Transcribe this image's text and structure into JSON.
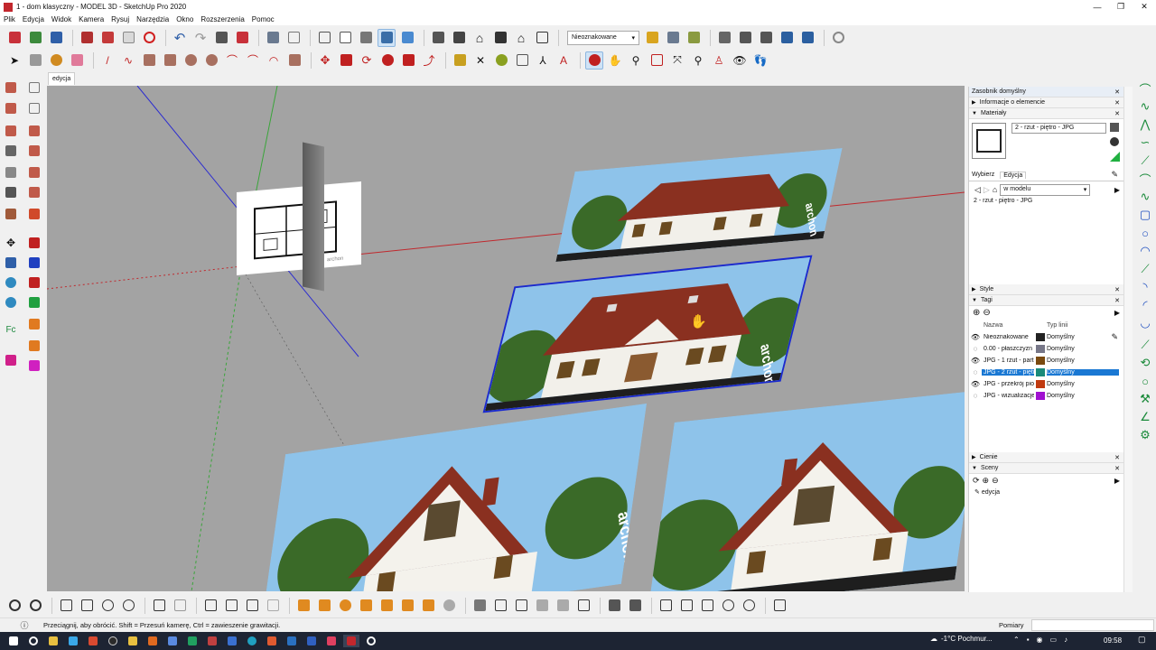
{
  "window": {
    "title": "1 - dom klasyczny - MODEL 3D - SketchUp Pro 2020",
    "controls": [
      "—",
      "❐",
      "✕"
    ]
  },
  "menu": [
    "Plik",
    "Edycja",
    "Widok",
    "Kamera",
    "Rysuj",
    "Narzędzia",
    "Okno",
    "Rozszerzenia",
    "Pomoc"
  ],
  "toolbar": {
    "style_dropdown": "Nieoznakowane",
    "scene_tab": "edycja"
  },
  "colors": {
    "viewport": "#a3a3a3",
    "axis_red": "#c0282d",
    "axis_green": "#3aa53a",
    "axis_blue": "#2b2bd0",
    "selection": "#1a78d3"
  },
  "scene_images": [
    {
      "label": "archon",
      "subject": "house-front-small"
    },
    {
      "label": "archon",
      "subject": "house-front-selected"
    },
    {
      "label": "archon",
      "subject": "house-side-left"
    },
    {
      "label": "archon",
      "subject": "house-side-right"
    }
  ],
  "tray": {
    "title": "Zasobnik domyślny",
    "entity_info": "Informacje o elemencie",
    "materials": {
      "label": "Materiały",
      "name_value": "2 - rzut - piętro - JPG",
      "tab_select": "Wybierz",
      "tab_edit": "Edycja",
      "library_value": "w modelu",
      "item": "2 - rzut - piętro - JPG"
    },
    "styles": "Style",
    "tags": {
      "label": "Tagi",
      "col_name": "Nazwa",
      "col_type": "Typ linii",
      "rows": [
        {
          "name": "Nieoznakowane",
          "type": "Domyślny",
          "color": "#222222",
          "visible": true
        },
        {
          "name": "0.00 - płaszczyzn",
          "type": "Domyślny",
          "color": "#777788",
          "visible": false
        },
        {
          "name": "JPG - 1 rzut - part",
          "type": "Domyślny",
          "color": "#7a4a10",
          "visible": true
        },
        {
          "name": "JPG - 2 rzut - piętr",
          "type": "Domyślny",
          "color": "#1a8a7a",
          "visible": false
        },
        {
          "name": "JPG - przekrój pio",
          "type": "Domyślny",
          "color": "#c03a10",
          "visible": true
        },
        {
          "name": "JPG - wizualizacje",
          "type": "Domyślny",
          "color": "#a010d0",
          "visible": true
        }
      ]
    },
    "shadows": "Cienie",
    "scenes": {
      "label": "Sceny",
      "item": "edycja"
    }
  },
  "status": {
    "hint": "Przeciągnij, aby obrócić. Shift = Przesuń kamerę, Ctrl = zawieszenie grawitacji.",
    "measure_label": "Pomiary"
  },
  "taskbar": {
    "weather": "-1°C Pochmur...",
    "time": "09:58"
  }
}
